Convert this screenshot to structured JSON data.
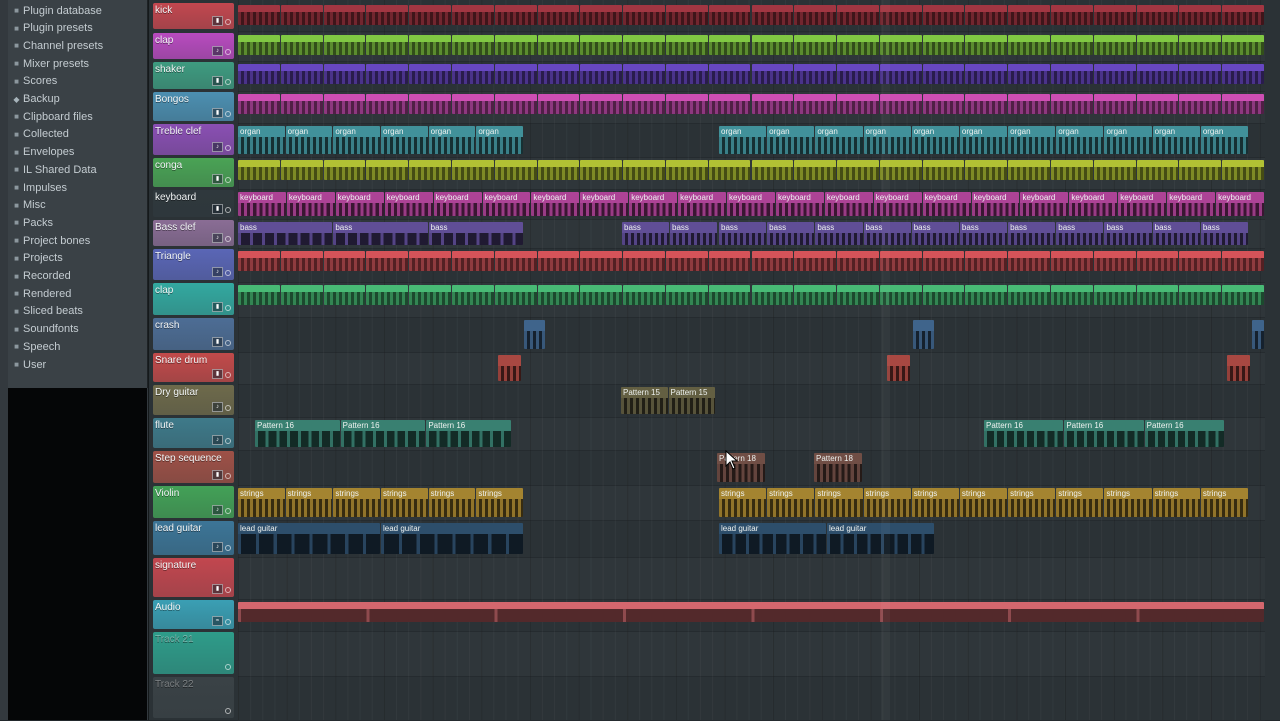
{
  "browser": {
    "items": [
      {
        "label": "Plugin database",
        "icon": "folder-icon"
      },
      {
        "label": "Plugin presets",
        "icon": "folder-icon"
      },
      {
        "label": "Channel presets",
        "icon": "folder-icon"
      },
      {
        "label": "Mixer presets",
        "icon": "folder-icon"
      },
      {
        "label": "Scores",
        "icon": "folder-icon"
      },
      {
        "label": "Backup",
        "icon": "star-folder-icon"
      },
      {
        "label": "Clipboard files",
        "icon": "folder-icon"
      },
      {
        "label": "Collected",
        "icon": "folder-icon"
      },
      {
        "label": "Envelopes",
        "icon": "folder-icon"
      },
      {
        "label": "IL Shared Data",
        "icon": "folder-icon"
      },
      {
        "label": "Impulses",
        "icon": "folder-icon"
      },
      {
        "label": "Misc",
        "icon": "folder-icon"
      },
      {
        "label": "Packs",
        "icon": "folder-icon"
      },
      {
        "label": "Project bones",
        "icon": "folder-icon"
      },
      {
        "label": "Projects",
        "icon": "folder-icon"
      },
      {
        "label": "Recorded",
        "icon": "folder-icon"
      },
      {
        "label": "Rendered",
        "icon": "folder-icon"
      },
      {
        "label": "Sliced beats",
        "icon": "folder-icon"
      },
      {
        "label": "Soundfonts",
        "icon": "folder-icon"
      },
      {
        "label": "Speech",
        "icon": "folder-icon"
      },
      {
        "label": "User",
        "icon": "folder-icon"
      }
    ]
  },
  "tracks": [
    {
      "name": "kick",
      "color": "#c2474f",
      "icon": "channel-icon"
    },
    {
      "name": "clap",
      "color": "#b84bbf",
      "icon": "plugin-icon"
    },
    {
      "name": "shaker",
      "color": "#3e9b80",
      "icon": "channel-icon"
    },
    {
      "name": "Bongos",
      "color": "#4c8fb1",
      "icon": "channel-icon"
    },
    {
      "name": "Treble clef",
      "color": "#8a4fb3",
      "icon": "plugin-icon"
    },
    {
      "name": "conga",
      "color": "#4aa355",
      "icon": "channel-icon"
    },
    {
      "name": "keyboard",
      "color": "#2f383d",
      "icon": "channel-icon"
    },
    {
      "name": "Bass clef",
      "color": "#8a6d95",
      "icon": "plugin-icon"
    },
    {
      "name": "Triangle",
      "color": "#5a66b6",
      "icon": "plugin-icon"
    },
    {
      "name": "clap",
      "color": "#33a9a0",
      "icon": "channel-icon"
    },
    {
      "name": "crash",
      "color": "#4d6d95",
      "icon": "channel-icon"
    },
    {
      "name": "Snare drum",
      "color": "#c24a4a",
      "icon": "channel-icon"
    },
    {
      "name": "Dry guitar",
      "color": "#6e6a4b",
      "icon": "plugin-icon"
    },
    {
      "name": "flute",
      "color": "#3e7a8a",
      "icon": "plugin-icon"
    },
    {
      "name": "Step sequence",
      "color": "#9e5147",
      "icon": "channel-icon"
    },
    {
      "name": "Violin",
      "color": "#43a157",
      "icon": "plugin-icon"
    },
    {
      "name": "lead guitar",
      "color": "#3c7597",
      "icon": "plugin-icon"
    },
    {
      "name": "signature",
      "color": "#c2474f",
      "icon": "channel-icon"
    },
    {
      "name": "Audio",
      "color": "#3a9fb4",
      "icon": "audio-icon"
    },
    {
      "name": "Track 21",
      "color": "#2e9c8a",
      "icon": ""
    },
    {
      "name": "Track 22",
      "color": "#3a4246",
      "icon": ""
    }
  ],
  "clips": [
    {
      "track": 0,
      "label": "",
      "start": 0,
      "end": 1027,
      "repeat": 24,
      "color": "#8c2f39",
      "strip": true
    },
    {
      "track": 1,
      "label": "",
      "start": 0,
      "end": 1027,
      "repeat": 24,
      "color": "#6fae3a",
      "strip": true
    },
    {
      "track": 2,
      "label": "",
      "start": 0,
      "end": 1027,
      "repeat": 24,
      "color": "#5a3ea8",
      "strip": true
    },
    {
      "track": 3,
      "label": "",
      "start": 0,
      "end": 1027,
      "repeat": 24,
      "color": "#b2449c",
      "strip": true
    },
    {
      "track": 4,
      "label": "organ",
      "start": 0,
      "end": 286,
      "repeat": 6,
      "color": "#3e8a93",
      "strip": false
    },
    {
      "track": 4,
      "label": "organ",
      "start": 481,
      "end": 1011,
      "repeat": 11,
      "color": "#3e8a93",
      "strip": false
    },
    {
      "track": 5,
      "label": "",
      "start": 0,
      "end": 1027,
      "repeat": 24,
      "color": "#9aa82d",
      "strip": true
    },
    {
      "track": 6,
      "label": "keyboard",
      "start": 0,
      "end": 1027,
      "repeat": 21,
      "color": "#a5408f",
      "strip": false
    },
    {
      "track": 7,
      "label": "bass",
      "start": 0,
      "end": 286,
      "repeat": 3,
      "color": "#5b4a8f",
      "strip": false
    },
    {
      "track": 7,
      "label": "bass",
      "start": 384,
      "end": 480,
      "repeat": 2,
      "color": "#5b4a8f",
      "strip": false
    },
    {
      "track": 7,
      "label": "bass",
      "start": 481,
      "end": 1011,
      "repeat": 11,
      "color": "#5b4a8f",
      "strip": false
    },
    {
      "track": 8,
      "label": "",
      "start": 0,
      "end": 1027,
      "repeat": 24,
      "color": "#b9484d",
      "strip": true
    },
    {
      "track": 9,
      "label": "",
      "start": 0,
      "end": 1027,
      "repeat": 24,
      "color": "#3fa266",
      "strip": true
    },
    {
      "track": 10,
      "label": "",
      "start": 286,
      "end": 308,
      "repeat": 1,
      "color": "#3c5f84",
      "strip": false
    },
    {
      "track": 10,
      "label": "",
      "start": 675,
      "end": 697,
      "repeat": 1,
      "color": "#3c5f84",
      "strip": false
    },
    {
      "track": 10,
      "label": "",
      "start": 1014,
      "end": 1027,
      "repeat": 1,
      "color": "#3c5f84",
      "strip": false
    },
    {
      "track": 11,
      "label": "",
      "start": 260,
      "end": 284,
      "repeat": 1,
      "color": "#a0453f",
      "strip": false
    },
    {
      "track": 11,
      "label": "",
      "start": 649,
      "end": 673,
      "repeat": 1,
      "color": "#a0453f",
      "strip": false
    },
    {
      "track": 11,
      "label": "",
      "start": 989,
      "end": 1013,
      "repeat": 1,
      "color": "#a0453f",
      "strip": false
    },
    {
      "track": 12,
      "label": "Pattern 15",
      "start": 383,
      "end": 478,
      "repeat": 2,
      "color": "#5e5a3f",
      "strip": false
    },
    {
      "track": 13,
      "label": "Pattern 16",
      "start": 17,
      "end": 274,
      "repeat": 3,
      "color": "#367a6c",
      "strip": false
    },
    {
      "track": 13,
      "label": "Pattern 16",
      "start": 746,
      "end": 987,
      "repeat": 3,
      "color": "#367a6c",
      "strip": false
    },
    {
      "track": 14,
      "label": "Pattern 18",
      "start": 479,
      "end": 528,
      "repeat": 1,
      "color": "#6b4a42",
      "strip": false
    },
    {
      "track": 14,
      "label": "Pattern 18",
      "start": 576,
      "end": 625,
      "repeat": 1,
      "color": "#6b4a42",
      "strip": false
    },
    {
      "track": 15,
      "label": "strings",
      "start": 0,
      "end": 286,
      "repeat": 6,
      "color": "#9c7e2e",
      "strip": false
    },
    {
      "track": 15,
      "label": "strings",
      "start": 481,
      "end": 1011,
      "repeat": 11,
      "color": "#9c7e2e",
      "strip": false
    },
    {
      "track": 16,
      "label": "lead guitar",
      "start": 0,
      "end": 286,
      "repeat": 2,
      "color": "#2b4a66",
      "strip": false
    },
    {
      "track": 16,
      "label": "lead guitar",
      "start": 481,
      "end": 697,
      "repeat": 2,
      "color": "#2b4a66",
      "strip": false
    },
    {
      "track": 18,
      "label": "",
      "start": 0,
      "end": 1027,
      "repeat": 1,
      "color": "#b85a60",
      "strip": true
    }
  ]
}
